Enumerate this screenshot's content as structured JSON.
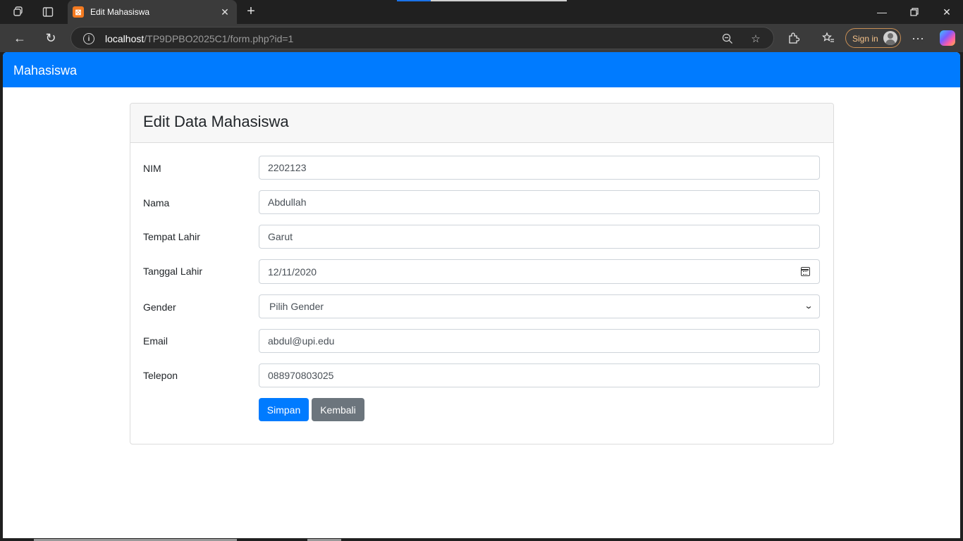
{
  "browser": {
    "tab_title": "Edit Mahasiswa",
    "favicon_glyph": "⊠",
    "url_host": "localhost",
    "url_path": "/TP9DPBO2025C1/form.php?id=1",
    "sign_in_label": "Sign in",
    "icons": [
      "workspaces-icon",
      "tab-actions-icon",
      "close-icon",
      "new-tab-icon",
      "back-icon",
      "refresh-icon",
      "info-icon",
      "zoom-out-icon",
      "favorite-star-icon",
      "extensions-icon",
      "favorites-icon",
      "more-icon",
      "copilot-icon"
    ]
  },
  "app": {
    "brand": "Mahasiswa",
    "accent_color": "#007bff"
  },
  "form": {
    "title": "Edit Data Mahasiswa",
    "fields": [
      {
        "label": "NIM",
        "value": "2202123"
      },
      {
        "label": "Nama",
        "value": "Abdullah"
      },
      {
        "label": "Tempat Lahir",
        "value": "Garut"
      },
      {
        "label": "Tanggal Lahir",
        "value": "12/11/2020"
      },
      {
        "label": "Gender",
        "value": "Pilih Gender"
      },
      {
        "label": "Email",
        "value": "abdul@upi.edu"
      },
      {
        "label": "Telepon",
        "value": "088970803025"
      }
    ],
    "submit_label": "Simpan",
    "back_label": "Kembali"
  }
}
